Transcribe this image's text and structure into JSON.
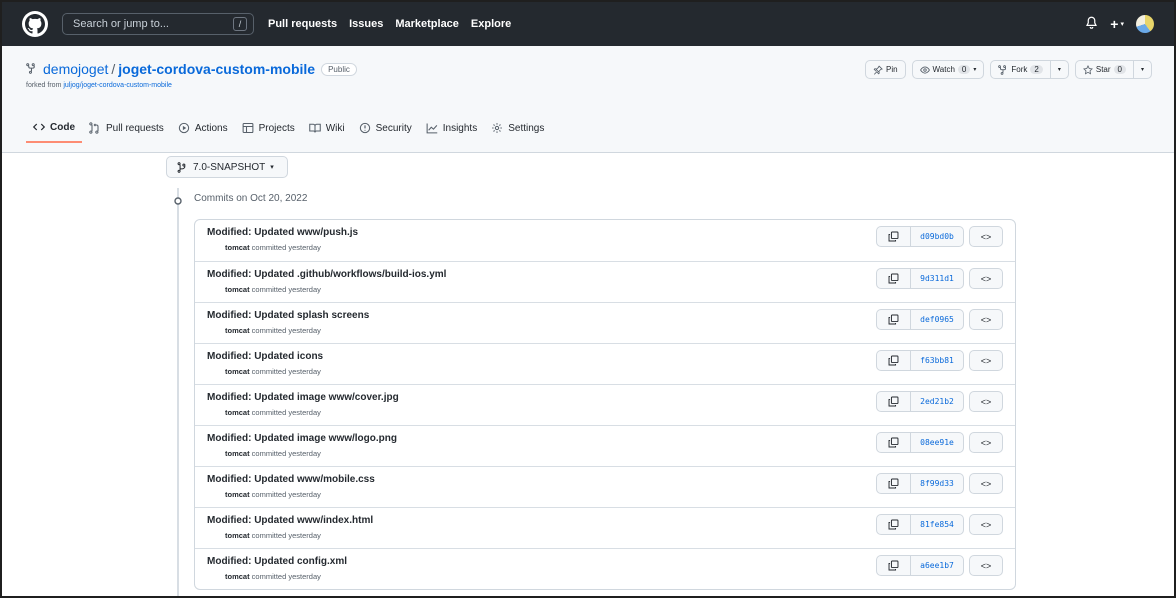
{
  "header": {
    "search_placeholder": "Search or jump to...",
    "search_shortcut": "/",
    "nav": [
      "Pull requests",
      "Issues",
      "Marketplace",
      "Explore"
    ],
    "plus_label": "+",
    "caret": "▾"
  },
  "repo": {
    "owner": "demojoget",
    "separator": "/",
    "name": "joget-cordova-custom-mobile",
    "visibility": "Public",
    "forked_prefix": "forked from ",
    "forked_source": "juljog/joget-cordova-custom-mobile",
    "actions": {
      "pin": "Pin",
      "watch": "Watch",
      "watch_count": "0",
      "fork": "Fork",
      "fork_count": "2",
      "star": "Star",
      "star_count": "0",
      "caret": "▾"
    }
  },
  "tabs": [
    {
      "label": "Code",
      "icon": "code-icon",
      "active": true
    },
    {
      "label": "Pull requests",
      "icon": "pull-request-icon"
    },
    {
      "label": "Actions",
      "icon": "play-icon"
    },
    {
      "label": "Projects",
      "icon": "table-icon"
    },
    {
      "label": "Wiki",
      "icon": "book-icon"
    },
    {
      "label": "Security",
      "icon": "shield-icon"
    },
    {
      "label": "Insights",
      "icon": "graph-icon"
    },
    {
      "label": "Settings",
      "icon": "gear-icon"
    }
  ],
  "branch": {
    "name": "7.0-SNAPSHOT",
    "caret": "▾"
  },
  "commits": {
    "group_title": "Commits on Oct 20, 2022",
    "committed_text": " committed yesterday",
    "browse_label": "<>",
    "items": [
      {
        "message": "Modified: Updated www/push.js",
        "author": "tomcat",
        "sha": "d09bd0b"
      },
      {
        "message": "Modified: Updated .github/workflows/build-ios.yml",
        "author": "tomcat",
        "sha": "9d311d1"
      },
      {
        "message": "Modified: Updated splash screens",
        "author": "tomcat",
        "sha": "def0965"
      },
      {
        "message": "Modified: Updated icons",
        "author": "tomcat",
        "sha": "f63bb81"
      },
      {
        "message": "Modified: Updated image www/cover.jpg",
        "author": "tomcat",
        "sha": "2ed21b2"
      },
      {
        "message": "Modified: Updated image www/logo.png",
        "author": "tomcat",
        "sha": "08ee91e"
      },
      {
        "message": "Modified: Updated www/mobile.css",
        "author": "tomcat",
        "sha": "8f99d33"
      },
      {
        "message": "Modified: Updated www/index.html",
        "author": "tomcat",
        "sha": "81fe854"
      },
      {
        "message": "Modified: Updated config.xml",
        "author": "tomcat",
        "sha": "a6ee1b7"
      }
    ]
  },
  "colors": {
    "header_bg": "#24292f",
    "link": "#0969da",
    "active_tab_underline": "#fd8c73"
  }
}
